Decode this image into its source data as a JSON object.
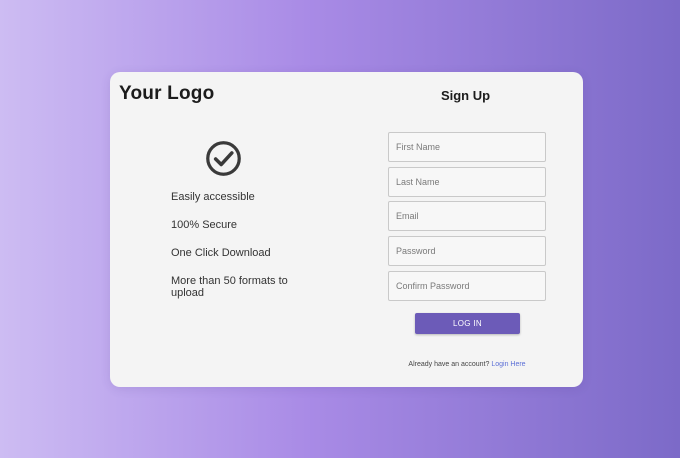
{
  "brand": {
    "logo_text": "Your Logo"
  },
  "features": [
    "Easily accessible",
    "100% Secure",
    "One Click Download",
    "More than 50 formats to upload"
  ],
  "icons": {
    "feature_icon": "check-circle-icon"
  },
  "form": {
    "title": "Sign Up",
    "fields": {
      "first_name": {
        "placeholder": "First Name",
        "value": ""
      },
      "last_name": {
        "placeholder": "Last Name",
        "value": ""
      },
      "email": {
        "placeholder": "Email",
        "value": ""
      },
      "password": {
        "placeholder": "Password",
        "value": ""
      },
      "confirm_password": {
        "placeholder": "Confirm Password",
        "value": ""
      }
    },
    "submit_label": "LOG IN",
    "footer_text": "Already have an account?",
    "footer_link": "Login Here"
  },
  "colors": {
    "accent": "#6c5bb8",
    "link": "#5b6fd6",
    "card_bg": "#f4f4f4",
    "gradient_start": "#cdbcf3",
    "gradient_end": "#7c6ac8"
  }
}
